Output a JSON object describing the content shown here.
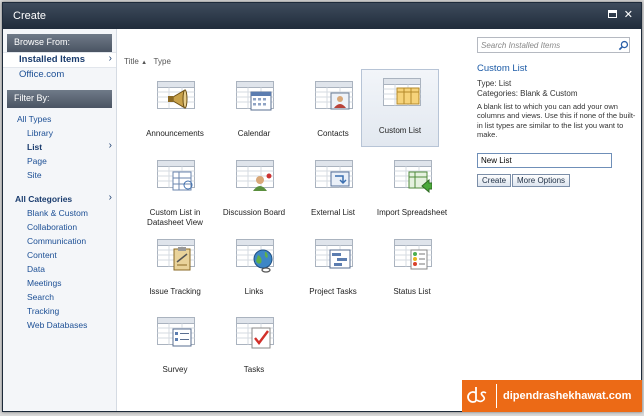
{
  "window": {
    "title": "Create"
  },
  "browse": {
    "header": "Browse From:",
    "items": [
      {
        "label": "Installed Items",
        "selected": true
      },
      {
        "label": "Office.com",
        "selected": false
      }
    ]
  },
  "filter": {
    "header": "Filter By:",
    "types": [
      {
        "label": "All Types",
        "level": 0
      },
      {
        "label": "Library",
        "level": 1
      },
      {
        "label": "List",
        "level": 1,
        "selected": true
      },
      {
        "label": "Page",
        "level": 1
      },
      {
        "label": "Site",
        "level": 1
      }
    ],
    "categories_header": "All Categories",
    "categories": [
      "Blank & Custom",
      "Collaboration",
      "Communication",
      "Content",
      "Data",
      "Meetings",
      "Search",
      "Tracking",
      "Web Databases"
    ]
  },
  "sort": {
    "title": "Title",
    "title_arrow": "▲",
    "type": "Type"
  },
  "templates": [
    {
      "label": "Announcements",
      "icon": "megaphone-icon"
    },
    {
      "label": "Calendar",
      "icon": "calendar-icon"
    },
    {
      "label": "Contacts",
      "icon": "contact-card-icon"
    },
    {
      "label": "Custom List",
      "icon": "custom-list-icon",
      "selected": true
    },
    {
      "label": "Custom List in Datasheet View",
      "icon": "datasheet-icon"
    },
    {
      "label": "Discussion Board",
      "icon": "discussion-icon"
    },
    {
      "label": "External List",
      "icon": "external-list-icon"
    },
    {
      "label": "Import Spreadsheet",
      "icon": "import-spreadsheet-icon"
    },
    {
      "label": "Issue Tracking",
      "icon": "clipboard-icon"
    },
    {
      "label": "Links",
      "icon": "globe-links-icon"
    },
    {
      "label": "Project Tasks",
      "icon": "gantt-icon"
    },
    {
      "label": "Status List",
      "icon": "status-list-icon"
    },
    {
      "label": "Survey",
      "icon": "survey-icon"
    },
    {
      "label": "Tasks",
      "icon": "task-check-icon"
    }
  ],
  "details": {
    "search_placeholder": "Search Installed Items",
    "title": "Custom List",
    "type_line": "Type: List",
    "categories_line": "Categories: Blank & Custom",
    "description": "A blank list to which you can add your own columns and views. Use this if none of the built-in list types are similar to the list you want to make.",
    "name_value": "New List",
    "create_label": "Create",
    "more_label": "More Options"
  },
  "watermark": {
    "text": "dipendrashekhawat.com"
  },
  "colors": {
    "accent": "#1b5aa6",
    "titlebar": "#2b3748",
    "watermark": "#ec6a16"
  }
}
